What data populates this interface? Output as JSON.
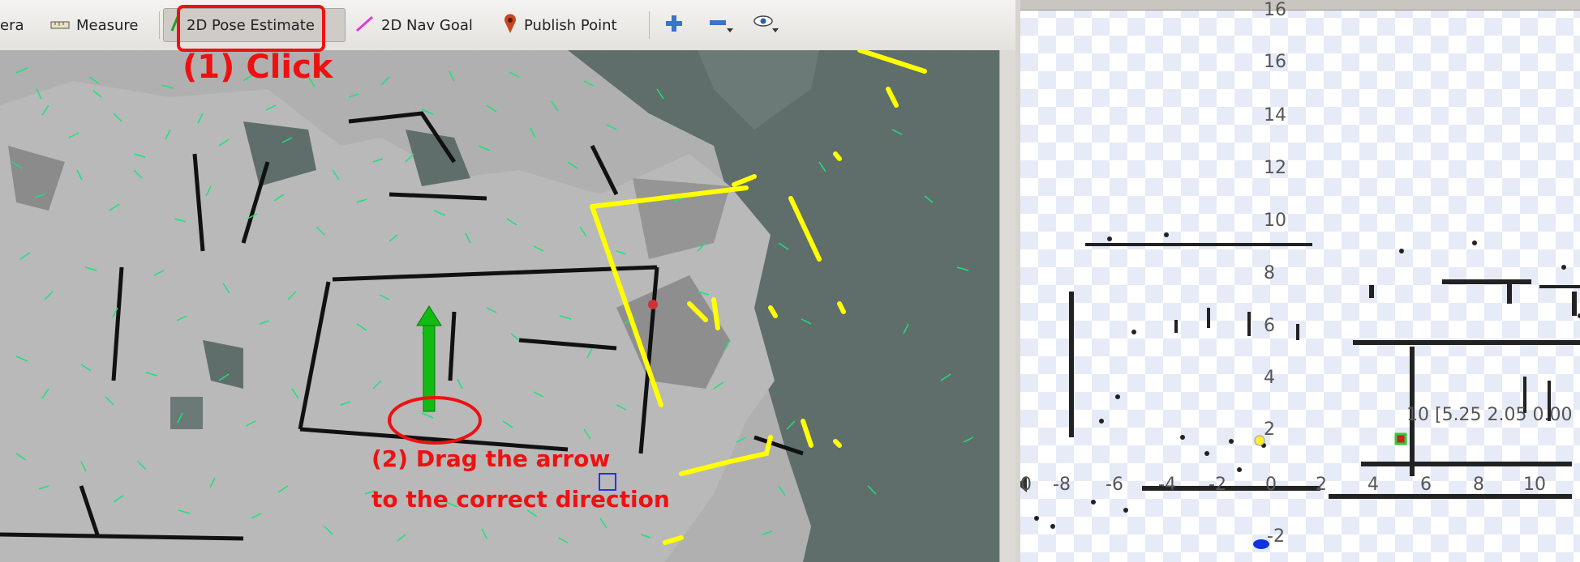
{
  "toolbar": {
    "camera_label": "era",
    "measure_label": "Measure",
    "pose_estimate_label": "2D Pose Estimate",
    "nav_goal_label": "2D Nav Goal",
    "publish_point_label": "Publish Point"
  },
  "annotations": {
    "step1": "(1) Click",
    "step2_line1": "(2) Drag the arrow",
    "step2_line2": "to the correct direction",
    "color": "#ee1111"
  },
  "plot": {
    "y_ticks": [
      "16",
      "14",
      "12",
      "10",
      "8",
      "6",
      "4",
      "2",
      "-2"
    ],
    "x_ticks": [
      "0",
      "-8",
      "-6",
      "-4",
      "-2",
      "0",
      "2",
      "4",
      "6",
      "8",
      "10"
    ],
    "point_label": "10 [5.25 2.05 0.00"
  },
  "colors": {
    "map_free": "#b2b2b2",
    "map_unknown": "#5f6e6b",
    "walls": "#111111",
    "particles": "#19e37a",
    "laser": "#ffff00",
    "pose_arrow": "#11bb11"
  }
}
